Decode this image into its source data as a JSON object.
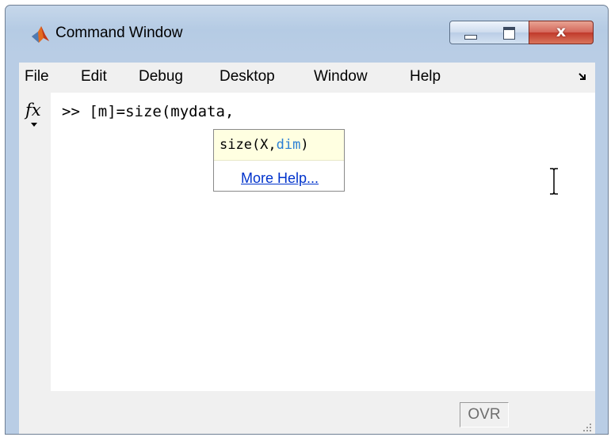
{
  "window": {
    "title": "Command Window",
    "app_icon": "matlab-logo-icon",
    "controls": {
      "minimize": "minimize-icon",
      "maximize": "maximize-icon",
      "close": "close-icon"
    },
    "close_glyph": "x"
  },
  "menu": {
    "items": [
      "File",
      "Edit",
      "Debug",
      "Desktop",
      "Window",
      "Help"
    ],
    "dock_icon": "undock-arrow-icon"
  },
  "command": {
    "fx_label": "fx",
    "prompt": ">>",
    "input": "[m]=size(mydata,"
  },
  "hint": {
    "function_name": "size(X,",
    "highlighted_arg": "dim",
    "closing": ")",
    "more_help": "More Help..."
  },
  "status": {
    "ovr": "OVR"
  },
  "colors": {
    "title_gradient": "#b9cde5",
    "hint_bg": "#ffffe1",
    "arg_highlight": "#2a7fd4",
    "link": "#0033cc"
  }
}
